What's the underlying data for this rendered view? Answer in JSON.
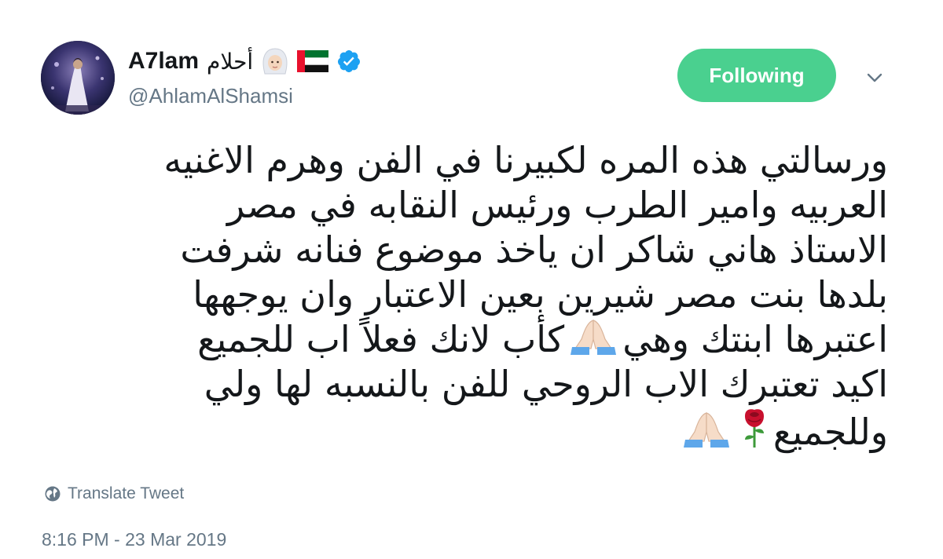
{
  "user": {
    "display_name_latin": "A7lam",
    "display_name_arabic": "أحلام",
    "handle": "@AhlamAlShamsi",
    "verified": true,
    "flag": "uae-flag-icon",
    "emoji": "woman-veil-emoji-icon"
  },
  "actions": {
    "follow_label": "Following",
    "menu_icon": "chevron-down-icon"
  },
  "tweet": {
    "lines": [
      "ورسالتي هذه المره لكبيرنا في الفن وهرم الاغنيه",
      "العربيه وامير الطرب ورئيس النقابه في مصر",
      "الاستاذ هاني شاكر ان ياخذ موضوع فنانه شرفت",
      "بلدها بنت مصر شيرين بعين الاعتبار وان يوجهها",
      "اعتبرها ابنتك وهي",
      "كأب لانك فعلاً اب للجميع",
      "اكيد تعتبرك الاب الروحي للفن بالنسبه لها ولي",
      "وللجميع"
    ],
    "emojis": [
      "praying-hands-icon",
      "rose-icon"
    ]
  },
  "footer": {
    "translate_label": "Translate Tweet",
    "timestamp": "8:16 PM - 23 Mar 2019"
  },
  "colors": {
    "follow_bg": "#4ad08f",
    "verified": "#1da1f2",
    "muted": "#657786",
    "text": "#14171a"
  }
}
